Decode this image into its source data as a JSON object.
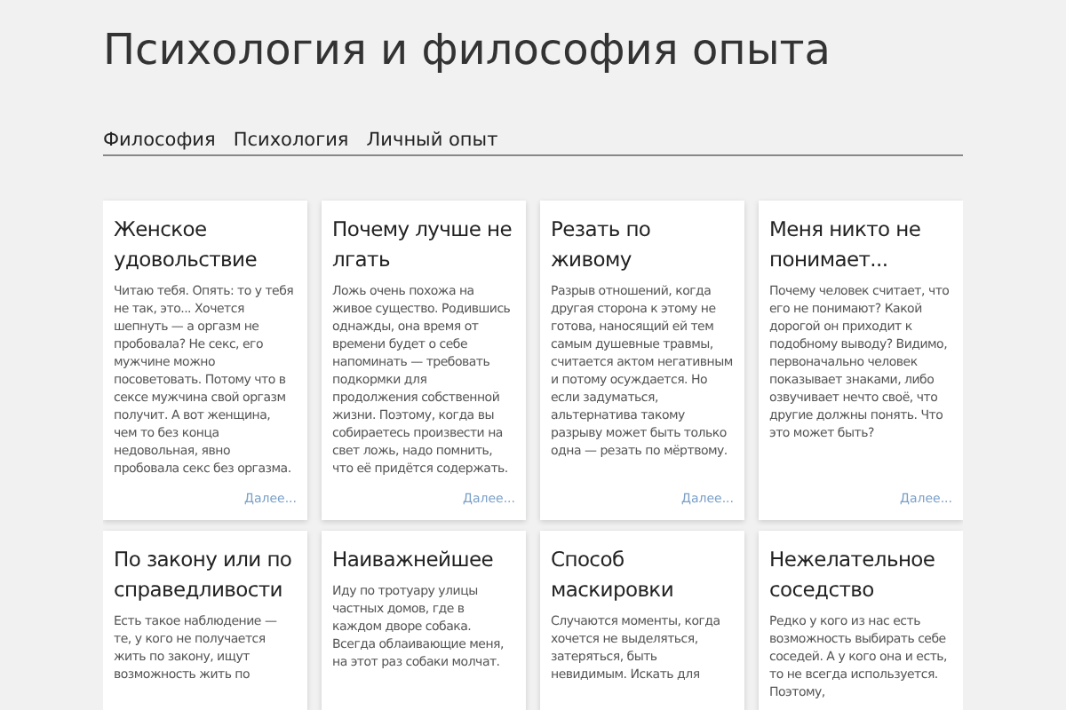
{
  "site_title": "Психология и философия опыта",
  "nav": [
    {
      "label": "Философия"
    },
    {
      "label": "Психология"
    },
    {
      "label": "Личный опыт"
    }
  ],
  "posts": [
    {
      "title": "Женское удовольствие",
      "excerpt": "Читаю тебя. Опять: то у тебя не так, это... Хочется шепнуть — а оргазм не пробовала? Не секс, его мужчине можно посоветовать. Потому что в сексе мужчина свой оргазм получит. А вот женщина, чем то без конца недовольная, явно пробовала секс без оргазма.",
      "more": "Далее..."
    },
    {
      "title": "Почему лучше не лгать",
      "excerpt": "Ложь очень похожа на живое существо. Родившись однажды, она время от времени будет о себе напоминать — требовать подкормки для продолжения собственной жизни. Поэтому, когда вы собираетесь произвести на свет ложь, надо помнить, что её придётся содержать.",
      "more": "Далее..."
    },
    {
      "title": "Резать по живому",
      "excerpt": "Разрыв отношений, когда другая сторона к этому не готова, наносящий ей тем самым душевные травмы, считается актом негативным и потому осуждается. Но если задуматься, альтернатива такому разрыву может быть только одна — резать по мёртвому.",
      "more": "Далее..."
    },
    {
      "title": "Меня никто не понимает...",
      "excerpt": "Почему человек считает, что его не понимают? Какой дорогой он приходит к подобному выводу? Видимо, первоначально человек показывает знаками, либо озвучивает нечто своё, что другие должны понять. Что это может быть?",
      "more": "Далее..."
    },
    {
      "title": "По закону или по справедливости",
      "excerpt": "Есть такое наблюдение — те, у кого не получается жить по закону, ищут возможность жить по"
    },
    {
      "title": "Наиважнейшее",
      "excerpt": "Иду по тротуару улицы частных домов, где в каждом дворе собака. Всегда облаивающие меня, на этот раз собаки молчат."
    },
    {
      "title": "Способ маскировки",
      "excerpt": "Случаются моменты, когда хочется не выделяться, затеряться, быть невидимым. Искать для"
    },
    {
      "title": "Нежелательное соседство",
      "excerpt": "Редко у кого из нас есть возможность выбирать себе соседей. А у кого она и есть, то не всегда используется. Поэтому,"
    }
  ]
}
